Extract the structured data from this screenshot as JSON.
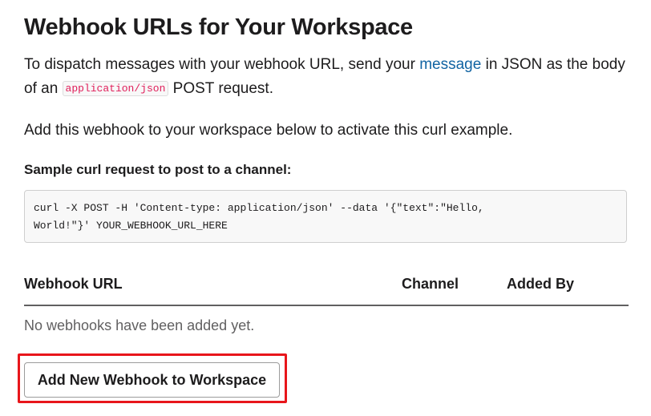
{
  "page_title": "Webhook URLs for Your Workspace",
  "intro": {
    "text_before_link": "To dispatch messages with your webhook URL, send your ",
    "link_text": "message",
    "text_after_link": " in JSON as the body of an ",
    "code": "application/json",
    "text_end": " POST request."
  },
  "add_note": "Add this webhook to your workspace below to activate this curl example.",
  "sample_heading": "Sample curl request to post to a channel:",
  "curl_example": "curl -X POST -H 'Content-type: application/json' --data '{\"text\":\"Hello,\nWorld!\"}' YOUR_WEBHOOK_URL_HERE",
  "table": {
    "columns": [
      "Webhook URL",
      "Channel",
      "Added By"
    ],
    "empty_message": "No webhooks have been added yet."
  },
  "add_button_label": "Add New Webhook to Workspace",
  "colors": {
    "link": "#1264a3",
    "inline_code": "#e01e5a",
    "highlight_border": "#e8161b"
  }
}
